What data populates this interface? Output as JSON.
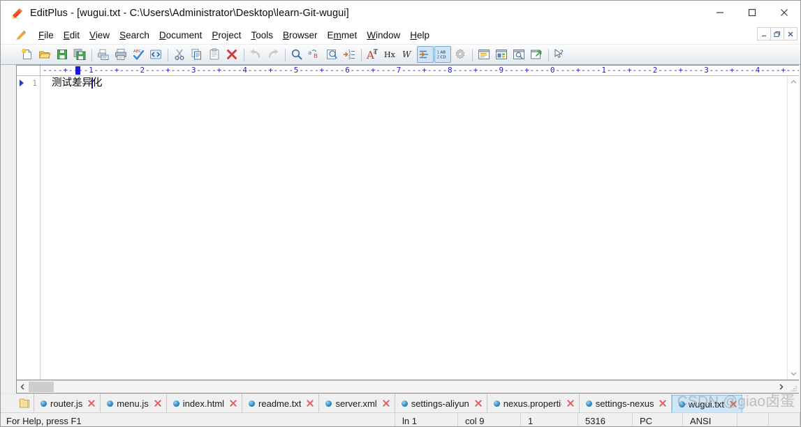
{
  "window": {
    "title": "EditPlus - [wugui.txt - C:\\Users\\Administrator\\Desktop\\learn-Git-wugui]",
    "app_icon": "editplus-icon",
    "minimize": "—",
    "maximize": "□",
    "close": "✕",
    "mdi_minimize": "_",
    "mdi_restore": "❐",
    "mdi_close": "✕"
  },
  "menubar": {
    "icon": "pencil-icon",
    "items": [
      {
        "label": "File",
        "accel": "F"
      },
      {
        "label": "Edit",
        "accel": "E"
      },
      {
        "label": "View",
        "accel": "V"
      },
      {
        "label": "Search",
        "accel": "S"
      },
      {
        "label": "Document",
        "accel": "D"
      },
      {
        "label": "Project",
        "accel": "P"
      },
      {
        "label": "Tools",
        "accel": "T"
      },
      {
        "label": "Browser",
        "accel": "B"
      },
      {
        "label": "Emmet",
        "accel": "m"
      },
      {
        "label": "Window",
        "accel": "W"
      },
      {
        "label": "Help",
        "accel": "H"
      }
    ]
  },
  "toolbar": {
    "buttons": [
      {
        "name": "new-file-icon",
        "tip": "New"
      },
      {
        "name": "open-file-icon",
        "tip": "Open"
      },
      {
        "name": "save-icon",
        "tip": "Save"
      },
      {
        "name": "save-all-icon",
        "tip": "Save All"
      },
      {
        "sep": true
      },
      {
        "name": "print-preview-icon",
        "tip": "Print Preview"
      },
      {
        "name": "print-icon",
        "tip": "Print"
      },
      {
        "name": "spell-check-icon",
        "tip": "Spell Check"
      },
      {
        "name": "view-source-icon",
        "tip": "View in Browser"
      },
      {
        "sep": true
      },
      {
        "name": "cut-icon",
        "tip": "Cut"
      },
      {
        "name": "copy-icon",
        "tip": "Copy"
      },
      {
        "name": "paste-icon",
        "tip": "Paste"
      },
      {
        "name": "delete-icon",
        "tip": "Delete"
      },
      {
        "sep": true
      },
      {
        "name": "undo-icon",
        "tip": "Undo"
      },
      {
        "name": "redo-icon",
        "tip": "Redo"
      },
      {
        "sep": true
      },
      {
        "name": "find-icon",
        "tip": "Find"
      },
      {
        "name": "replace-icon",
        "tip": "Replace"
      },
      {
        "name": "find-in-files-icon",
        "tip": "Find in Files"
      },
      {
        "name": "goto-line-icon",
        "tip": "Go to Line"
      },
      {
        "sep": true
      },
      {
        "name": "font-icon",
        "tip": "Font"
      },
      {
        "name": "hex-view-icon",
        "tip": "Hex Viewer"
      },
      {
        "name": "word-wrap-icon",
        "tip": "Word Wrap"
      },
      {
        "name": "auto-indent-icon",
        "tip": "Auto Indent",
        "active": true
      },
      {
        "name": "line-numbers-icon",
        "tip": "Line Numbers",
        "active": true
      },
      {
        "name": "preferences-icon",
        "tip": "Preferences"
      },
      {
        "sep": true
      },
      {
        "name": "document-selector-icon",
        "tip": "Document Selector"
      },
      {
        "name": "output-window-icon",
        "tip": "Output Window"
      },
      {
        "name": "clip-library-icon",
        "tip": "Cliptext Window"
      },
      {
        "name": "browser-preview-icon",
        "tip": "Browser Preview"
      },
      {
        "sep": true
      },
      {
        "name": "context-help-icon",
        "tip": "Context Help"
      }
    ]
  },
  "ruler": {
    "scale": "----+----1----+----2----+----3----+----4----+----5----+----6----+----7----+----8----+----9----+----0----+----1----+----2----+----3----+----4----+----5-"
  },
  "editor": {
    "lines": [
      {
        "number": "1",
        "text_before_caret": "测试差异",
        "text_after_caret": "化",
        "fold_marker": true
      }
    ]
  },
  "tabs": {
    "folder_icon": "folder-icon",
    "items": [
      {
        "label": "router.js",
        "active": false
      },
      {
        "label": "menu.js",
        "active": false
      },
      {
        "label": "index.html",
        "active": false
      },
      {
        "label": "readme.txt",
        "active": false
      },
      {
        "label": "server.xml",
        "active": false
      },
      {
        "label": "settings-aliyun.",
        "active": false
      },
      {
        "label": "nexus.propertie",
        "active": false
      },
      {
        "label": "settings-nexus.",
        "active": false
      },
      {
        "label": "wugui.txt",
        "active": true
      }
    ]
  },
  "statusbar": {
    "help": "For Help, press F1",
    "line": "ln 1",
    "column": "col 9",
    "selection": "1",
    "size": "5316",
    "platform": "PC",
    "encoding": "ANSI",
    "extra1": "",
    "extra2": ""
  },
  "watermark": "CSDN @giao卤蛋",
  "colors": {
    "accent": "#cfe6f7",
    "accent_border": "#8fbde0",
    "ruler_blue": "#1a1ad0",
    "close_red": "#e06464",
    "tab_dot_blue": "#2f8ccb"
  }
}
